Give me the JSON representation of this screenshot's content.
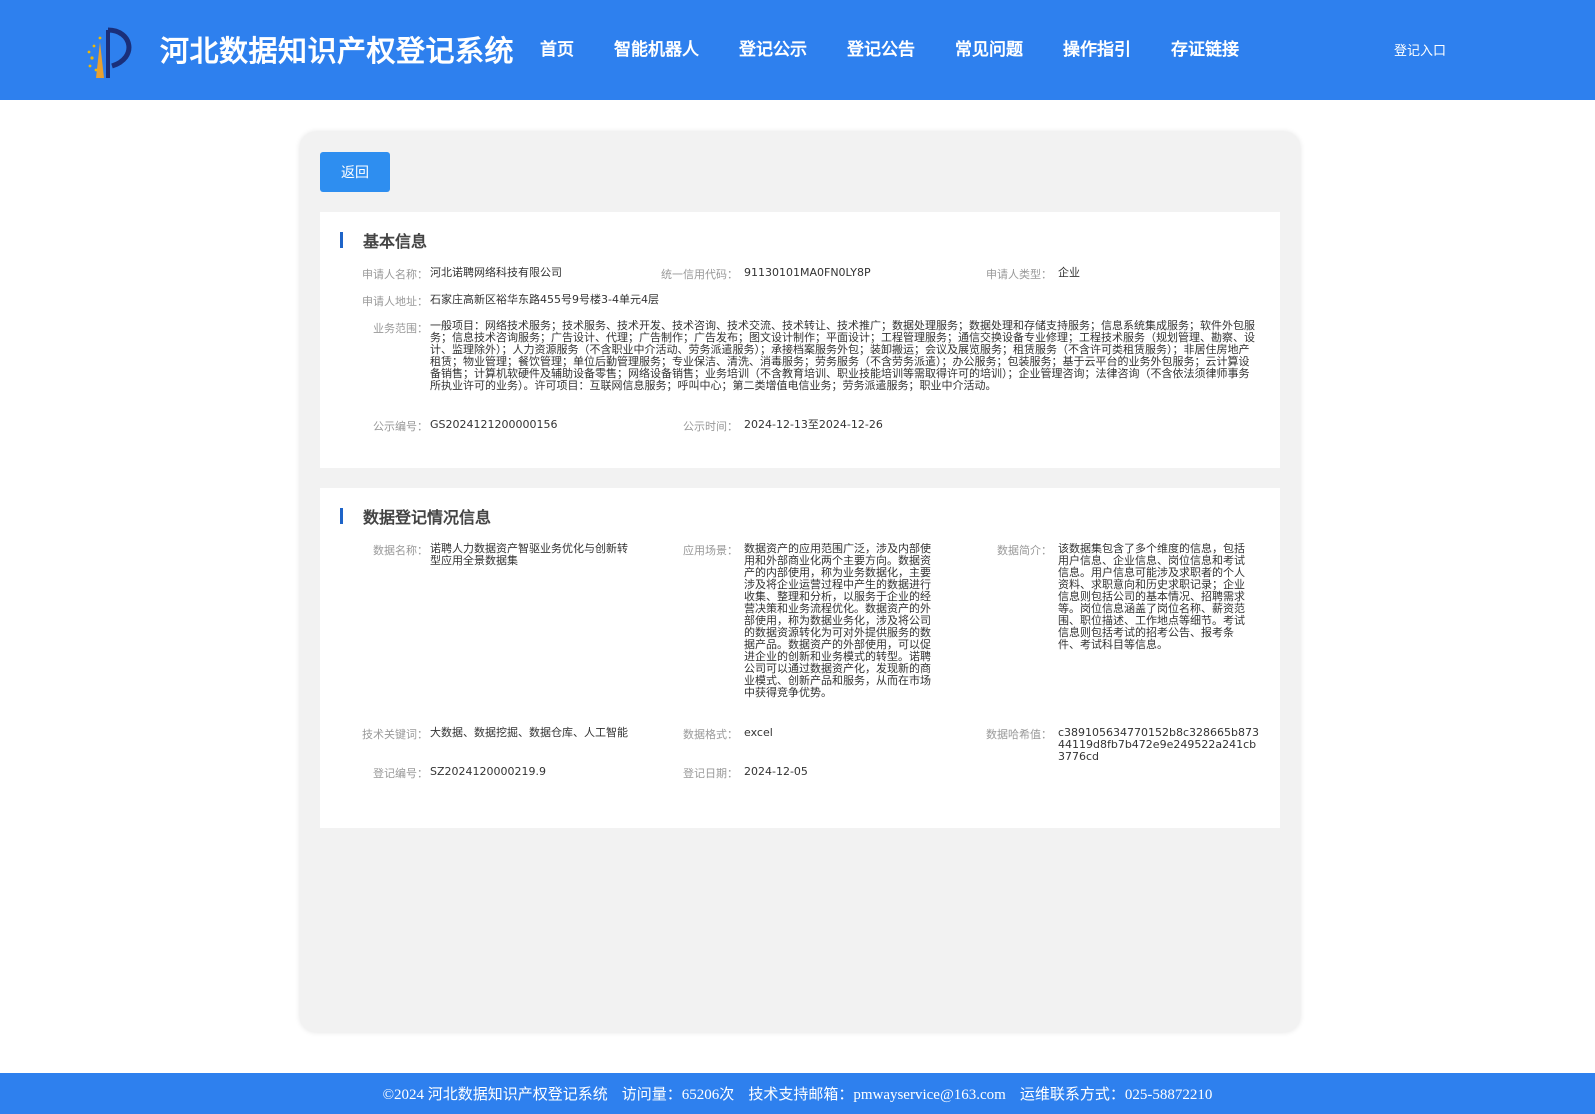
{
  "header": {
    "title": "河北数据知识产权登记系统",
    "nav": [
      "首页",
      "智能机器人",
      "登记公示",
      "登记公告",
      "常见问题",
      "操作指引",
      "存证链接"
    ],
    "login": "登记入口"
  },
  "back_label": "返回",
  "basic": {
    "title": "基本信息",
    "applicant_name_label": "申请人名称：",
    "applicant_name": "河北诺聘网络科技有限公司",
    "credit_code_label": "统一信用代码：",
    "credit_code": "91130101MA0FN0LY8P",
    "applicant_type_label": "申请人类型：",
    "applicant_type": "企业",
    "address_label": "申请人地址：",
    "address": "石家庄高新区裕华东路455号9号楼3-4单元4层",
    "scope_label": "业务范围：",
    "scope": "一般项目：网络技术服务；技术服务、技术开发、技术咨询、技术交流、技术转让、技术推广；数据处理服务；数据处理和存储支持服务；信息系统集成服务；软件外包服务；信息技术咨询服务；广告设计、代理；广告制作；广告发布；图文设计制作；平面设计；工程管理服务；通信交换设备专业修理；工程技术服务（规划管理、勘察、设计、监理除外）；人力资源服务（不含职业中介活动、劳务派遣服务）；承接档案服务外包；装卸搬运；会议及展览服务；租赁服务（不含许可类租赁服务）；非居住房地产租赁；物业管理；餐饮管理；单位后勤管理服务；专业保洁、清洗、消毒服务；劳务服务（不含劳务派遣）；办公服务；包装服务；基于云平台的业务外包服务；云计算设备销售；计算机软硬件及辅助设备零售；网络设备销售；业务培训（不含教育培训、职业技能培训等需取得许可的培训）；企业管理咨询；法律咨询（不含依法须律师事务所执业许可的业务）。许可项目：互联网信息服务；呼叫中心；第二类增值电信业务；劳务派遣服务；职业中介活动。",
    "notice_no_label": "公示编号：",
    "notice_no": "GS2024121200000156",
    "notice_time_label": "公示时间：",
    "notice_time": "2024-12-13至2024-12-26"
  },
  "data_reg": {
    "title": "数据登记情况信息",
    "data_name_label": "数据名称：",
    "data_name": "诺聘人力数据资产智驱业务优化与创新转型应用全景数据集",
    "scenario_label": "应用场景：",
    "scenario": "数据资产的应用范围广泛，涉及内部使用和外部商业化两个主要方向。数据资产的内部使用，称为业务数据化，主要涉及将企业运营过程中产生的数据进行收集、整理和分析，以服务于企业的经营决策和业务流程优化。数据资产的外部使用，称为数据业务化，涉及将公司的数据资源转化为可对外提供服务的数据产品。数据资产的外部使用，可以促进企业的创新和业务模式的转型。诺聘公司可以通过数据资产化，发现新的商业模式、创新产品和服务，从而在市场中获得竞争优势。",
    "intro_label": "数据简介：",
    "intro": "该数据集包含了多个维度的信息，包括用户信息、企业信息、岗位信息和考试信息。用户信息可能涉及求职者的个人资料、求职意向和历史求职记录；企业信息则包括公司的基本情况、招聘需求等。岗位信息涵盖了岗位名称、薪资范围、职位描述、工作地点等细节。考试信息则包括考试的招考公告、报考条件、考试科目等信息。",
    "keywords_label": "技术关键词：",
    "keywords": "大数据、数据挖掘、数据仓库、人工智能",
    "format_label": "数据格式：",
    "format": "excel",
    "hash_label": "数据哈希值：",
    "hash": "c389105634770152b8c328665b87344119d8fb7b472e9e249522a241cb3776cd",
    "reg_no_label": "登记编号：",
    "reg_no": "SZ2024120000219.9",
    "reg_date_label": "登记日期：",
    "reg_date": "2024-12-05"
  },
  "footer": {
    "copyright": "©2024 河北数据知识产权登记系统",
    "visits": "访问量：65206次",
    "email": "技术支持邮箱：pmwayservice@163.com",
    "contact": "运维联系方式：025-58872210"
  },
  "colors": {
    "primary": "#2e80ee",
    "button": "#2e8ef0",
    "section_bar": "#1e64c8"
  }
}
